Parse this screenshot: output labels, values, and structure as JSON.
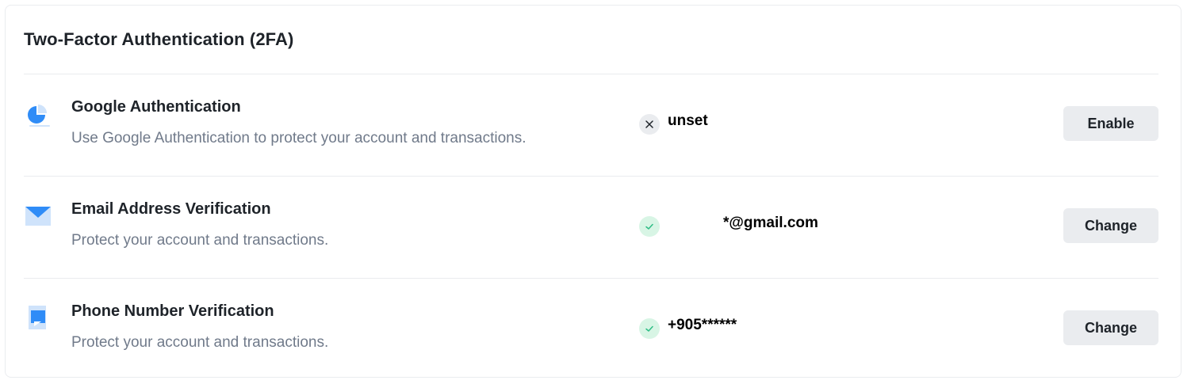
{
  "section": {
    "title": "Two-Factor Authentication (2FA)"
  },
  "methods": [
    {
      "label": "Google Authentication",
      "description": "Use Google Authentication to protect your account and transactions.",
      "status_value": "unset",
      "enabled": false,
      "button_label": "Enable",
      "icon": "pie-chart-icon"
    },
    {
      "label": "Email Address Verification",
      "description": "Protect your account and transactions.",
      "status_value": "*@gmail.com",
      "enabled": true,
      "button_label": "Change",
      "icon": "envelope-icon"
    },
    {
      "label": "Phone Number Verification",
      "description": "Protect your account and transactions.",
      "status_value": "+905******",
      "enabled": true,
      "button_label": "Change",
      "icon": "phone-message-icon"
    }
  ],
  "colors": {
    "accent_blue": "#2f8cf7",
    "accent_blue_light": "#cfe3fb",
    "success_bg": "#d8f5e5",
    "success_check": "#2ebd85",
    "neutral_bg": "#eaecef",
    "text_primary": "#1e2329",
    "text_secondary": "#707a8a"
  }
}
